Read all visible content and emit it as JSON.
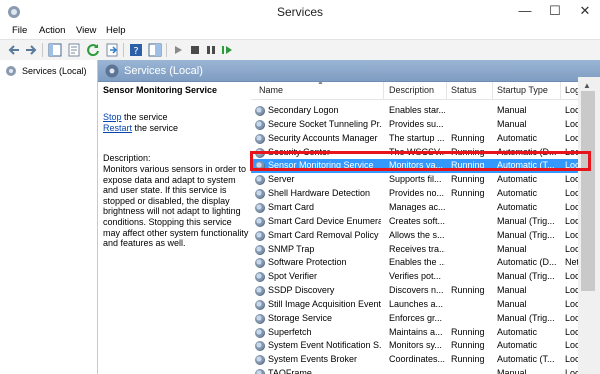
{
  "window": {
    "title": "Services",
    "minimize": "—",
    "maximize": "☐",
    "close": "✕"
  },
  "menu": [
    "File",
    "Action",
    "View",
    "Help"
  ],
  "tree": {
    "label": "Services (Local)"
  },
  "panel_header": "Services (Local)",
  "description_pane": {
    "service_name": "Sensor Monitoring Service",
    "stop_link": "Stop",
    "stop_suffix": " the service",
    "restart_link": "Restart",
    "restart_suffix": " the service",
    "description_label": "Description:",
    "description_text": "Monitors various sensors in order to expose data and adapt to system and user state.  If this service is stopped or disabled, the display brightness will not adapt to lighting conditions. Stopping this service may affect other system functionality and features as well."
  },
  "columns": [
    "Name",
    "Description",
    "Status",
    "Startup Type",
    "Log"
  ],
  "rows": [
    {
      "name": "Secondary Logon",
      "description": "Enables star...",
      "status": "",
      "startup": "Manual",
      "log": "Loc"
    },
    {
      "name": "Secure Socket Tunneling Pr...",
      "description": "Provides su...",
      "status": "",
      "startup": "Manual",
      "log": "Loc"
    },
    {
      "name": "Security Accounts Manager",
      "description": "The startup ...",
      "status": "Running",
      "startup": "Automatic",
      "log": "Loc"
    },
    {
      "name": "Security Center",
      "description": "The WSCSV...",
      "status": "Running",
      "startup": "Automatic (D...",
      "log": "Loc"
    },
    {
      "name": "Sensor Monitoring Service",
      "description": "Monitors va...",
      "status": "Running",
      "startup": "Automatic (T...",
      "log": "Loc"
    },
    {
      "name": "Server",
      "description": "Supports fil...",
      "status": "Running",
      "startup": "Automatic",
      "log": "Loc"
    },
    {
      "name": "Shell Hardware Detection",
      "description": "Provides no...",
      "status": "Running",
      "startup": "Automatic",
      "log": "Loc"
    },
    {
      "name": "Smart Card",
      "description": "Manages ac...",
      "status": "",
      "startup": "Automatic",
      "log": "Loc"
    },
    {
      "name": "Smart Card Device Enumera...",
      "description": "Creates soft...",
      "status": "",
      "startup": "Manual (Trig...",
      "log": "Loc"
    },
    {
      "name": "Smart Card Removal Policy",
      "description": "Allows the s...",
      "status": "",
      "startup": "Manual (Trig...",
      "log": "Loc"
    },
    {
      "name": "SNMP Trap",
      "description": "Receives tra...",
      "status": "",
      "startup": "Manual",
      "log": "Loc"
    },
    {
      "name": "Software Protection",
      "description": "Enables the ...",
      "status": "",
      "startup": "Automatic (D...",
      "log": "Net"
    },
    {
      "name": "Spot Verifier",
      "description": "Verifies pot...",
      "status": "",
      "startup": "Manual (Trig...",
      "log": "Loc"
    },
    {
      "name": "SSDP Discovery",
      "description": "Discovers n...",
      "status": "Running",
      "startup": "Manual",
      "log": "Loc"
    },
    {
      "name": "Still Image Acquisition Events",
      "description": "Launches a...",
      "status": "",
      "startup": "Manual",
      "log": "Loc"
    },
    {
      "name": "Storage Service",
      "description": "Enforces gr...",
      "status": "",
      "startup": "Manual (Trig...",
      "log": "Loc"
    },
    {
      "name": "Superfetch",
      "description": "Maintains a...",
      "status": "Running",
      "startup": "Automatic",
      "log": "Loc"
    },
    {
      "name": "System Event Notification S...",
      "description": "Monitors sy...",
      "status": "Running",
      "startup": "Automatic",
      "log": "Loc"
    },
    {
      "name": "System Events Broker",
      "description": "Coordinates...",
      "status": "Running",
      "startup": "Automatic (T...",
      "log": "Loc"
    },
    {
      "name": "TAOFrame",
      "description": "",
      "status": "",
      "startup": "Manual",
      "log": "Loc"
    }
  ],
  "selected_row": 4,
  "colors": {
    "selection": "#3399ff",
    "highlight_box": "#e8141c",
    "header_band": "#8aa8cb"
  }
}
